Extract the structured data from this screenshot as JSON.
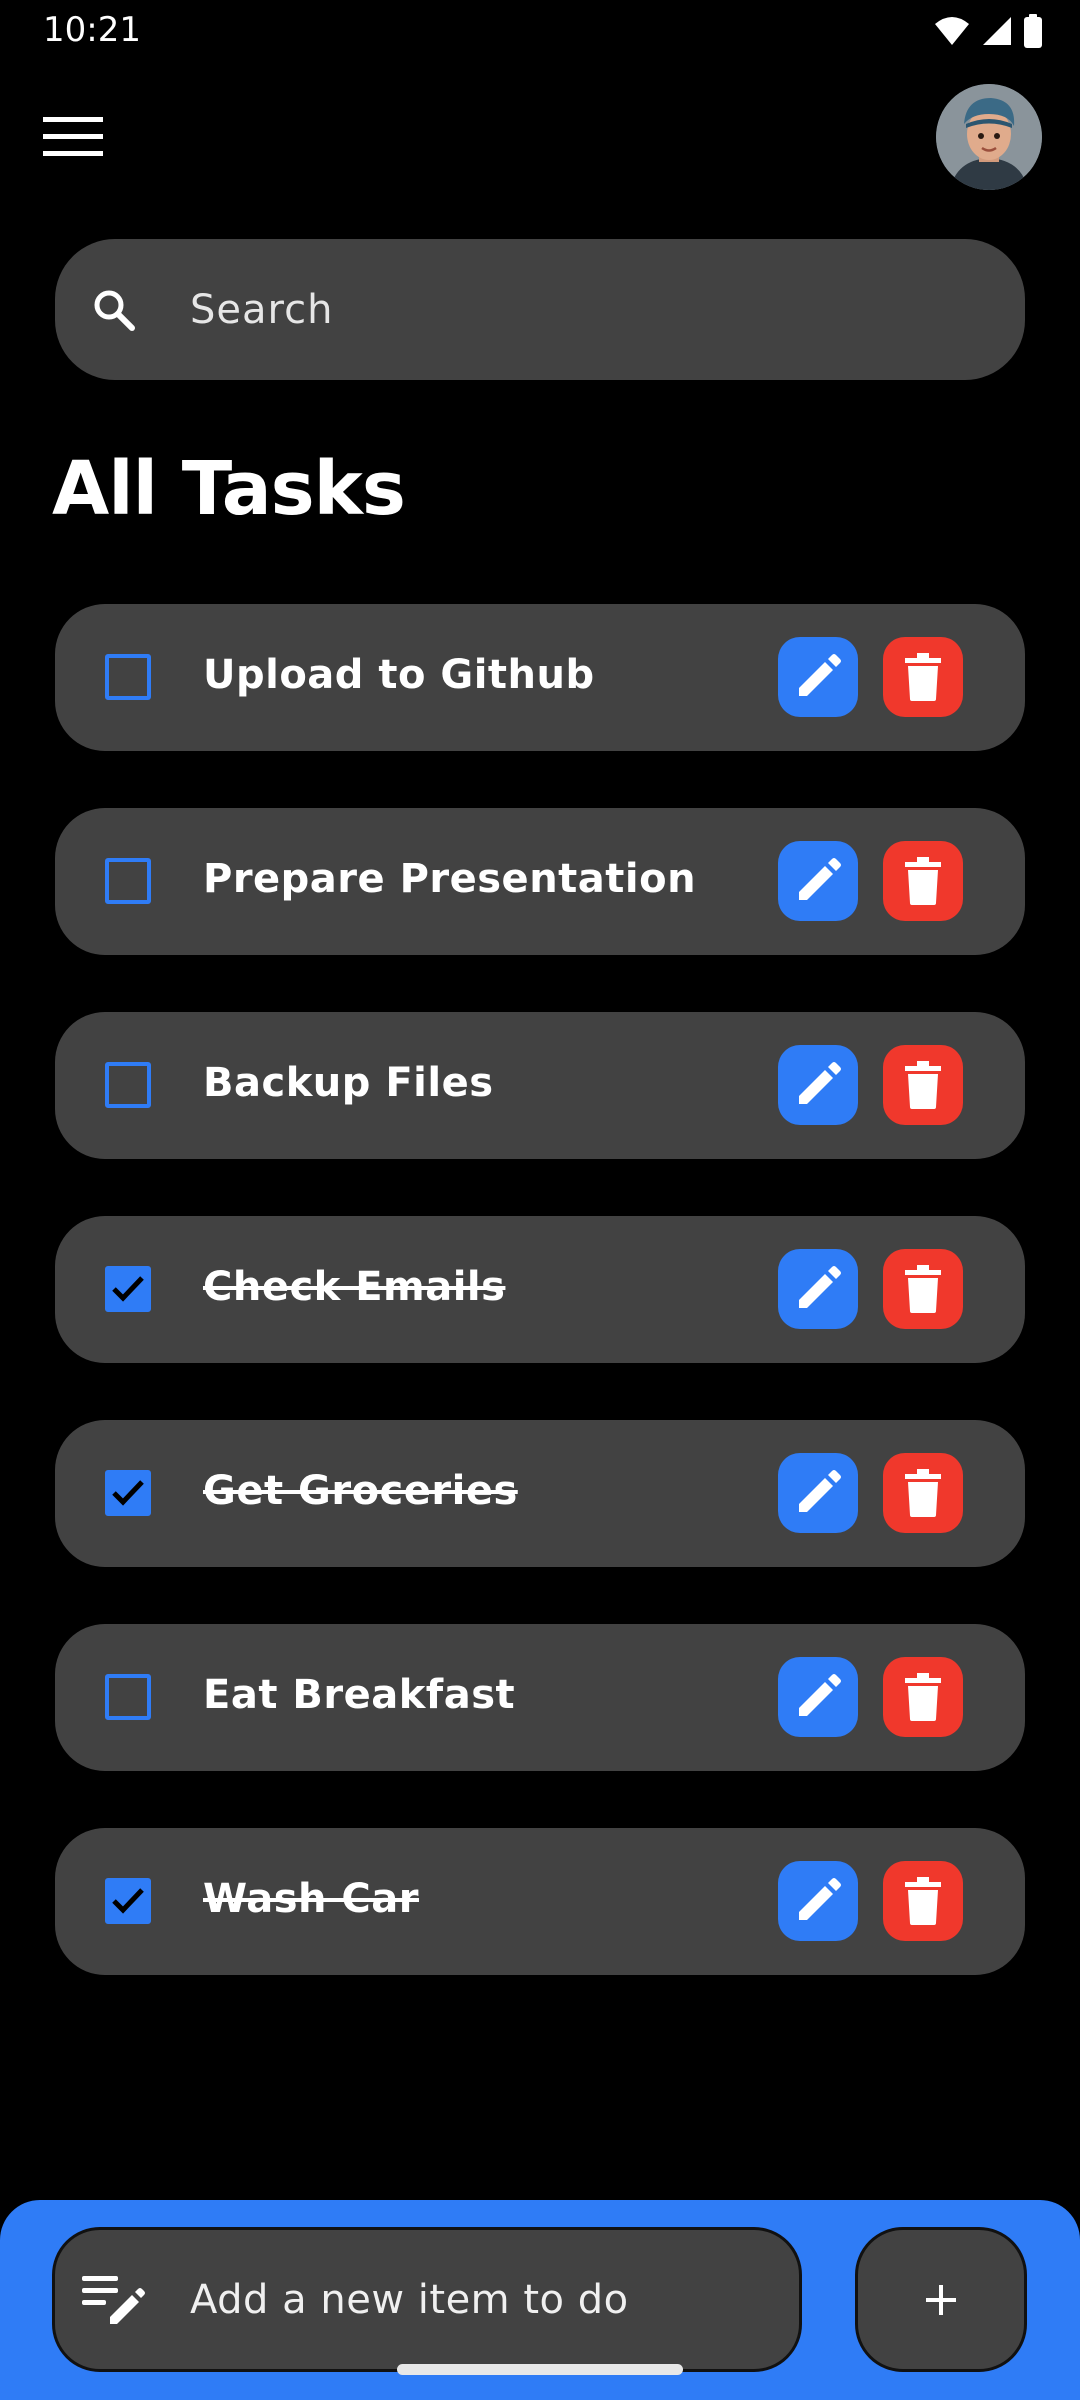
{
  "status_bar": {
    "time": "10:21",
    "icons": [
      "wifi-icon",
      "signal-icon",
      "battery-icon"
    ]
  },
  "app_bar": {
    "menu_icon": "hamburger-menu-icon",
    "avatar": "user-avatar"
  },
  "search": {
    "placeholder": "Search",
    "value": "",
    "icon": "search-icon"
  },
  "page_title": "All Tasks",
  "tasks": [
    {
      "label": "Upload to Github",
      "done": false
    },
    {
      "label": "Prepare Presentation",
      "done": false
    },
    {
      "label": "Backup Files",
      "done": false
    },
    {
      "label": "Check Emails",
      "done": true
    },
    {
      "label": "Get Groceries",
      "done": true
    },
    {
      "label": "Eat Breakfast",
      "done": false
    },
    {
      "label": "Wash Car",
      "done": true
    }
  ],
  "task_actions": {
    "edit_icon": "pencil-icon",
    "delete_icon": "trash-icon"
  },
  "add_bar": {
    "placeholder": "Add a new item to do",
    "value": "",
    "add_label": "+",
    "icon": "notes-edit-icon"
  },
  "colors": {
    "accent": "#2f7cf6",
    "delete": "#f0382c",
    "card": "#424242",
    "background": "#000000"
  }
}
